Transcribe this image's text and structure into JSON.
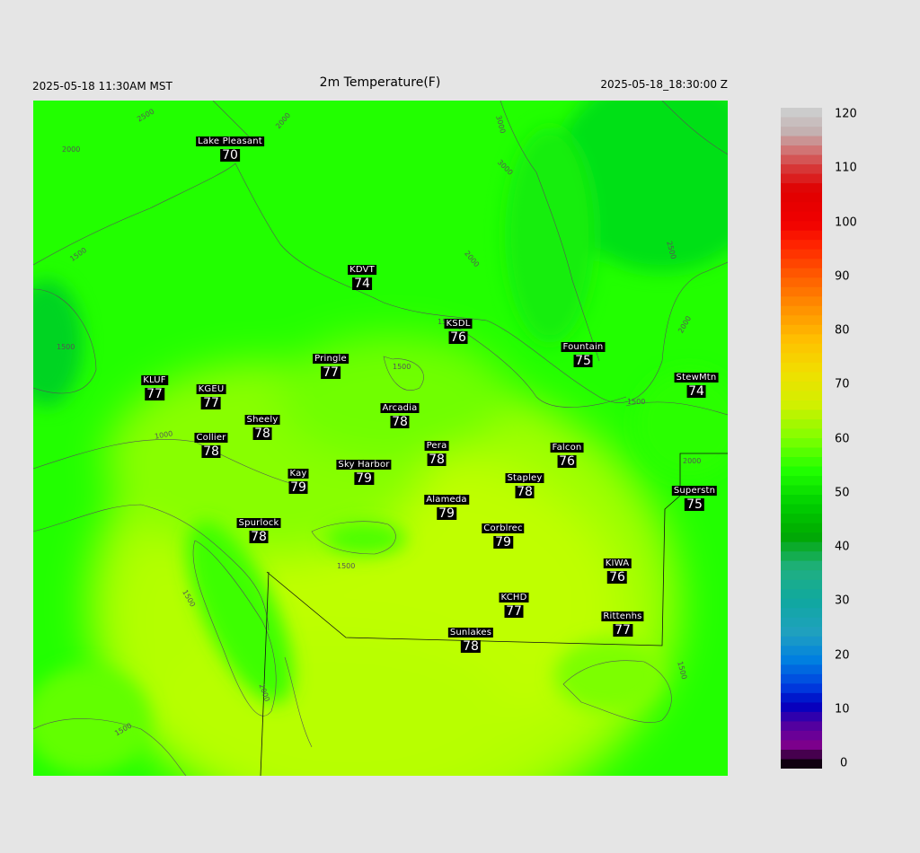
{
  "header": {
    "local_time": "2025-05-18 11:30AM MST",
    "title": "2m Temperature(F)",
    "utc_time": "2025-05-18_18:30:00 Z"
  },
  "colors": {
    "background": "#e5e5e5",
    "field_warm": "#bfff00",
    "field_cool": "#22ff00",
    "contour": "#555555",
    "station_box": "#000000"
  },
  "stations": [
    {
      "name": "Lake Pleasant",
      "temp": "70"
    },
    {
      "name": "KDVT",
      "temp": "74"
    },
    {
      "name": "KSDL",
      "temp": "76"
    },
    {
      "name": "Fountain",
      "temp": "75"
    },
    {
      "name": "StewMtn",
      "temp": "74"
    },
    {
      "name": "Pringle",
      "temp": "77"
    },
    {
      "name": "KLUF",
      "temp": "77"
    },
    {
      "name": "KGEU",
      "temp": "77"
    },
    {
      "name": "Arcadia",
      "temp": "78"
    },
    {
      "name": "Sheely",
      "temp": "78"
    },
    {
      "name": "Collier",
      "temp": "78"
    },
    {
      "name": "Pera",
      "temp": "78"
    },
    {
      "name": "Falcon",
      "temp": "76"
    },
    {
      "name": "Kay",
      "temp": "79"
    },
    {
      "name": "Sky Harbor",
      "temp": "79"
    },
    {
      "name": "Stapley",
      "temp": "78"
    },
    {
      "name": "Superstn",
      "temp": "75"
    },
    {
      "name": "Alameda",
      "temp": "79"
    },
    {
      "name": "Spurlock",
      "temp": "78"
    },
    {
      "name": "Corblrec",
      "temp": "79"
    },
    {
      "name": "KIWA",
      "temp": "76"
    },
    {
      "name": "KCHD",
      "temp": "77"
    },
    {
      "name": "Rittenhs",
      "temp": "77"
    },
    {
      "name": "Sunlakes",
      "temp": "78"
    }
  ],
  "contour_labels": [
    "2500",
    "2000",
    "2000",
    "3000",
    "3000",
    "2000",
    "2500",
    "2000",
    "1500",
    "1500",
    "1500",
    "1500",
    "1000",
    "2000",
    "1500",
    "1500",
    "1500",
    "2000",
    "1500",
    "1500"
  ],
  "colorbar": {
    "ticks": [
      "120",
      "110",
      "100",
      "90",
      "80",
      "70",
      "60",
      "50",
      "40",
      "30",
      "20",
      "10",
      "0"
    ]
  }
}
